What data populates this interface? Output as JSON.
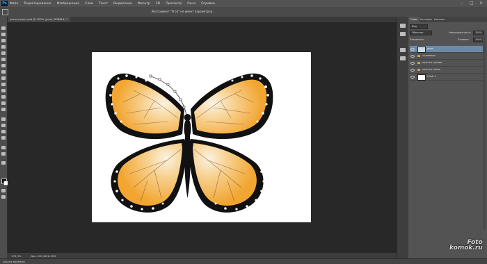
{
  "menubar": {
    "logo": "Ps",
    "items": [
      "Файл",
      "Редактирование",
      "Изображение",
      "Слои",
      "Текст",
      "Выделение",
      "Фильтр",
      "3D",
      "Просмотр",
      "Окно",
      "Справка"
    ],
    "window_controls": [
      "–",
      "□",
      "×"
    ]
  },
  "options_bar": {
    "hint": "Инструмент \"Угол\" не имеет параметров."
  },
  "document": {
    "tab_label": "ногочи-разт.psd @ 133% (усик, RGB/8#) *",
    "zoom": "133,3%",
    "doc_info": "Док: 961,6K/6,29M"
  },
  "timeline": {
    "label": "Шкала времени"
  },
  "panel": {
    "tabs": [
      "Слои",
      "Истории",
      "Каналы"
    ],
    "search_label": "Вид",
    "blend_mode": "Обычные",
    "opacity_label": "Непрозрачность:",
    "opacity_value": "100%",
    "lock_label": "Закрепить:",
    "fill_label": "Заливка:",
    "fill_value": "100%",
    "layers": [
      {
        "name": "усик",
        "type": "layer",
        "selected": true
      },
      {
        "name": "туловище",
        "type": "group",
        "selected": false
      },
      {
        "name": "крылья справа",
        "type": "group",
        "selected": false
      },
      {
        "name": "крылья слева",
        "type": "group",
        "selected": false
      },
      {
        "name": "Слой 1",
        "type": "layer",
        "selected": false
      }
    ]
  },
  "watermark": {
    "line1": "Foto",
    "line2": "komok.ru"
  },
  "colors": {
    "wing_orange": "#f2a530",
    "wing_light": "#f8e7c9",
    "selected_layer": "#6d89a9"
  }
}
